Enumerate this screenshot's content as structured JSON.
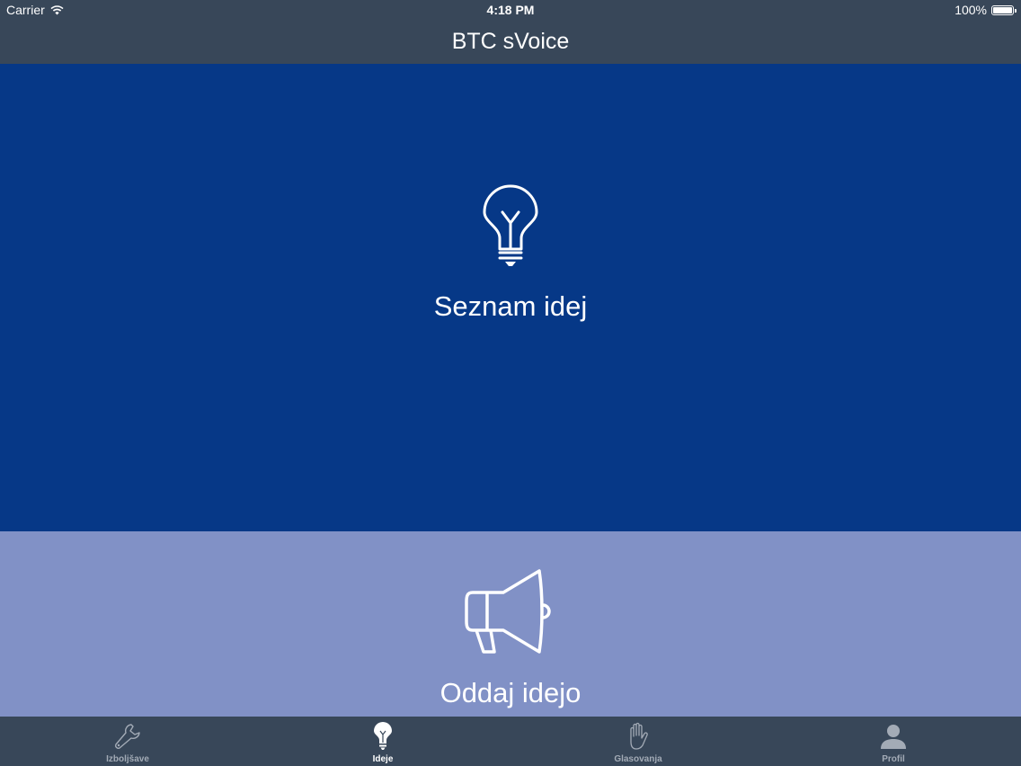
{
  "status_bar": {
    "carrier": "Carrier",
    "time": "4:18 PM",
    "battery": "100%"
  },
  "nav": {
    "title": "BTC sVoice"
  },
  "panels": [
    {
      "label": "Seznam idej",
      "icon": "lightbulb-icon",
      "color": "#063887"
    },
    {
      "label": "Oddaj idejo",
      "icon": "megaphone-icon",
      "color": "#8191c6"
    }
  ],
  "tabs": [
    {
      "label": "Izboljšave",
      "icon": "wrench-icon",
      "active": false
    },
    {
      "label": "Ideje",
      "icon": "lightbulb-icon",
      "active": true
    },
    {
      "label": "Glasovanja",
      "icon": "hand-icon",
      "active": false
    },
    {
      "label": "Profil",
      "icon": "person-icon",
      "active": false
    }
  ],
  "colors": {
    "bar_background": "#384759",
    "active_tab": "#ffffff",
    "inactive_tab": "#a3abb6"
  }
}
